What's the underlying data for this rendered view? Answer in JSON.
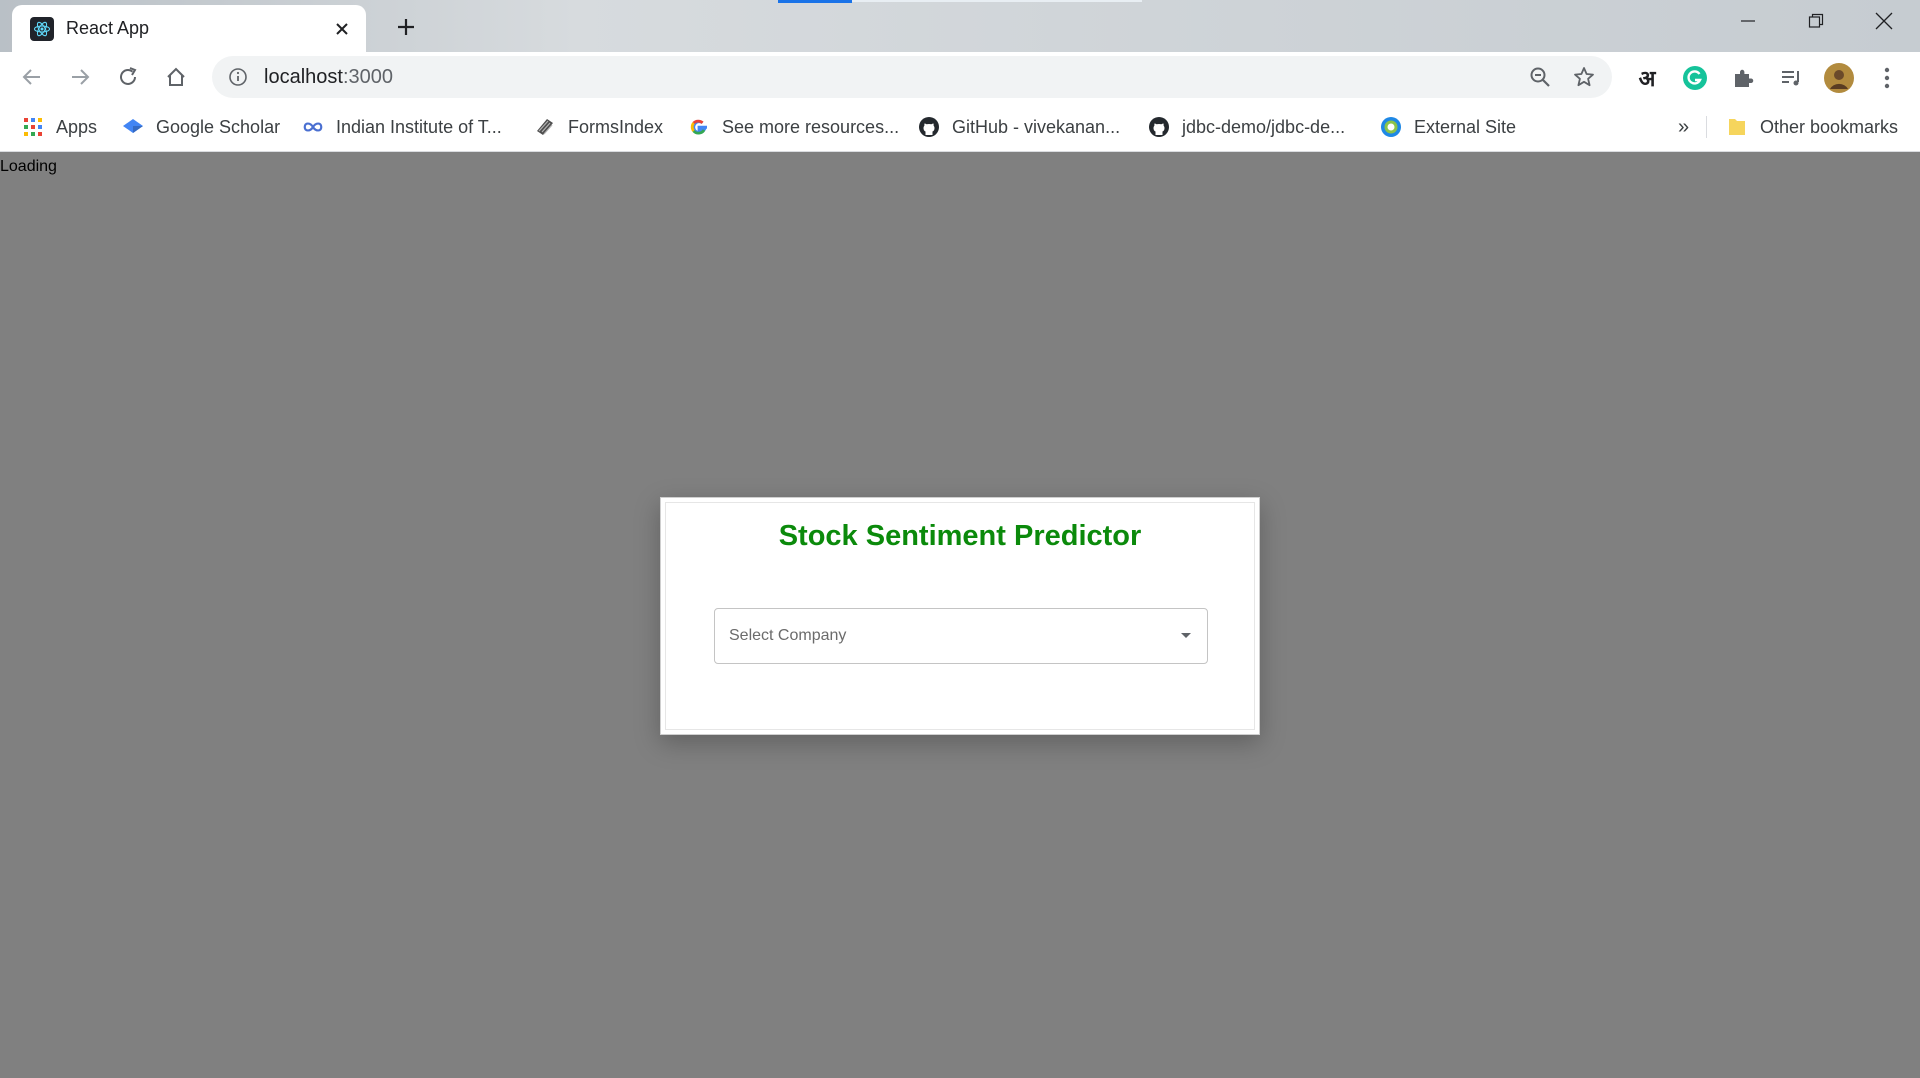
{
  "browser": {
    "tab": {
      "title": "React App"
    },
    "omnibox": {
      "host": "localhost",
      "port": ":3000"
    },
    "ext_devanagari": "अ",
    "bookmarks": [
      {
        "label": "Apps",
        "icon": "apps-grid-icon"
      },
      {
        "label": "Google Scholar",
        "icon": "scholar-icon"
      },
      {
        "label": "Indian Institute of T...",
        "icon": "infinity-icon"
      },
      {
        "label": "FormsIndex",
        "icon": "formsindex-icon"
      },
      {
        "label": "See more resources...",
        "icon": "google-icon"
      },
      {
        "label": "GitHub - vivekanan...",
        "icon": "github-icon"
      },
      {
        "label": "jdbc-demo/jdbc-de...",
        "icon": "github-icon"
      },
      {
        "label": "External Site",
        "icon": "external-site-icon"
      }
    ],
    "overflow": "»",
    "other_bookmarks": "Other bookmarks"
  },
  "page": {
    "loading": "Loading",
    "title": "Stock Sentiment Predictor",
    "select": {
      "placeholder": "Select Company"
    }
  },
  "colors": {
    "title_green": "#0b8a0b",
    "page_bg": "#808080",
    "accent_blue": "#1a73e8"
  }
}
